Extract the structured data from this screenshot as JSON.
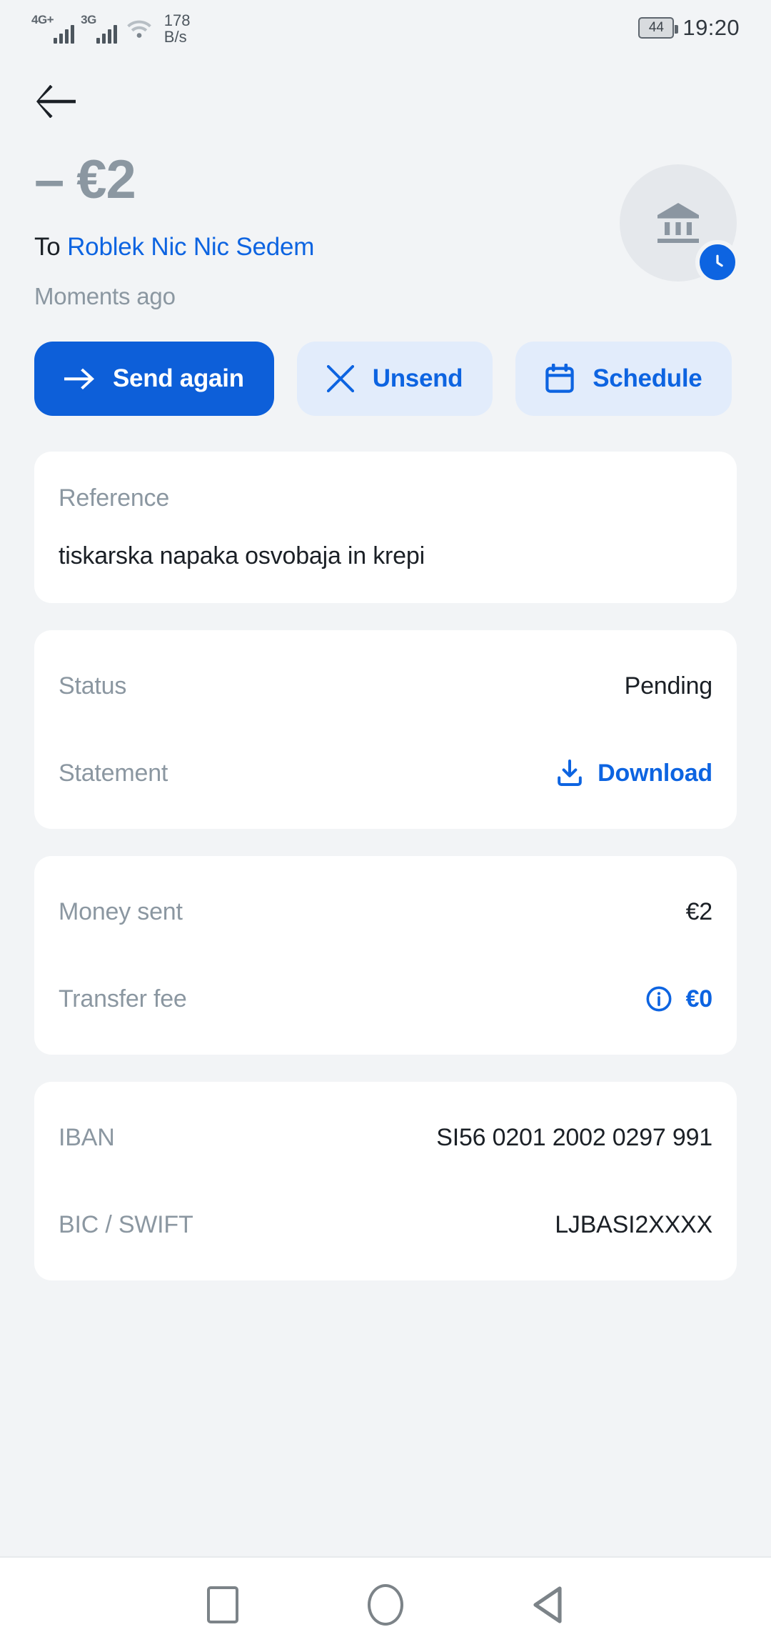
{
  "status_bar": {
    "network_primary": "4G+",
    "network_secondary": "3G",
    "data_speed_value": "178",
    "data_speed_unit": "B/s",
    "battery_level": "44",
    "time": "19:20"
  },
  "nav": {
    "back_icon": "arrow-left-icon"
  },
  "transaction": {
    "amount_sign": "–",
    "amount": "€2",
    "to_label": "To",
    "recipient": "Roblek Nic Nic Sedem",
    "time_ago": "Moments ago",
    "avatar_icon": "bank-icon",
    "status_badge_icon": "clock-icon"
  },
  "actions": [
    {
      "label": "Send again",
      "icon": "arrow-right-icon",
      "style": "primary"
    },
    {
      "label": "Unsend",
      "icon": "close-icon",
      "style": "ghost"
    },
    {
      "label": "Schedule",
      "icon": "calendar-icon",
      "style": "ghost"
    }
  ],
  "reference_card": {
    "label": "Reference",
    "value": "tiskarska napaka osvobaja in krepi"
  },
  "status_card": {
    "status_label": "Status",
    "status_value": "Pending",
    "statement_label": "Statement",
    "statement_action": "Download",
    "statement_icon": "download-icon"
  },
  "amounts_card": {
    "money_sent_label": "Money sent",
    "money_sent_value": "€2",
    "transfer_fee_label": "Transfer fee",
    "transfer_fee_value": "€0",
    "transfer_fee_icon": "info-icon"
  },
  "bank_card": {
    "iban_label": "IBAN",
    "iban_value": "SI56 0201 2002 0297 991",
    "bic_label": "BIC / SWIFT",
    "bic_value": "LJBASI2XXXX"
  },
  "system_nav": {
    "recents_icon": "square-icon",
    "home_icon": "circle-icon",
    "back_icon": "triangle-back-icon"
  },
  "colors": {
    "accent": "#0d64e1",
    "primary_button": "#0d5fd9",
    "ghost_button": "#e2ecfb",
    "page_bg": "#f2f4f6",
    "card_bg": "#ffffff",
    "label_gray": "#8b97a1",
    "text_dark": "#1b2026"
  }
}
